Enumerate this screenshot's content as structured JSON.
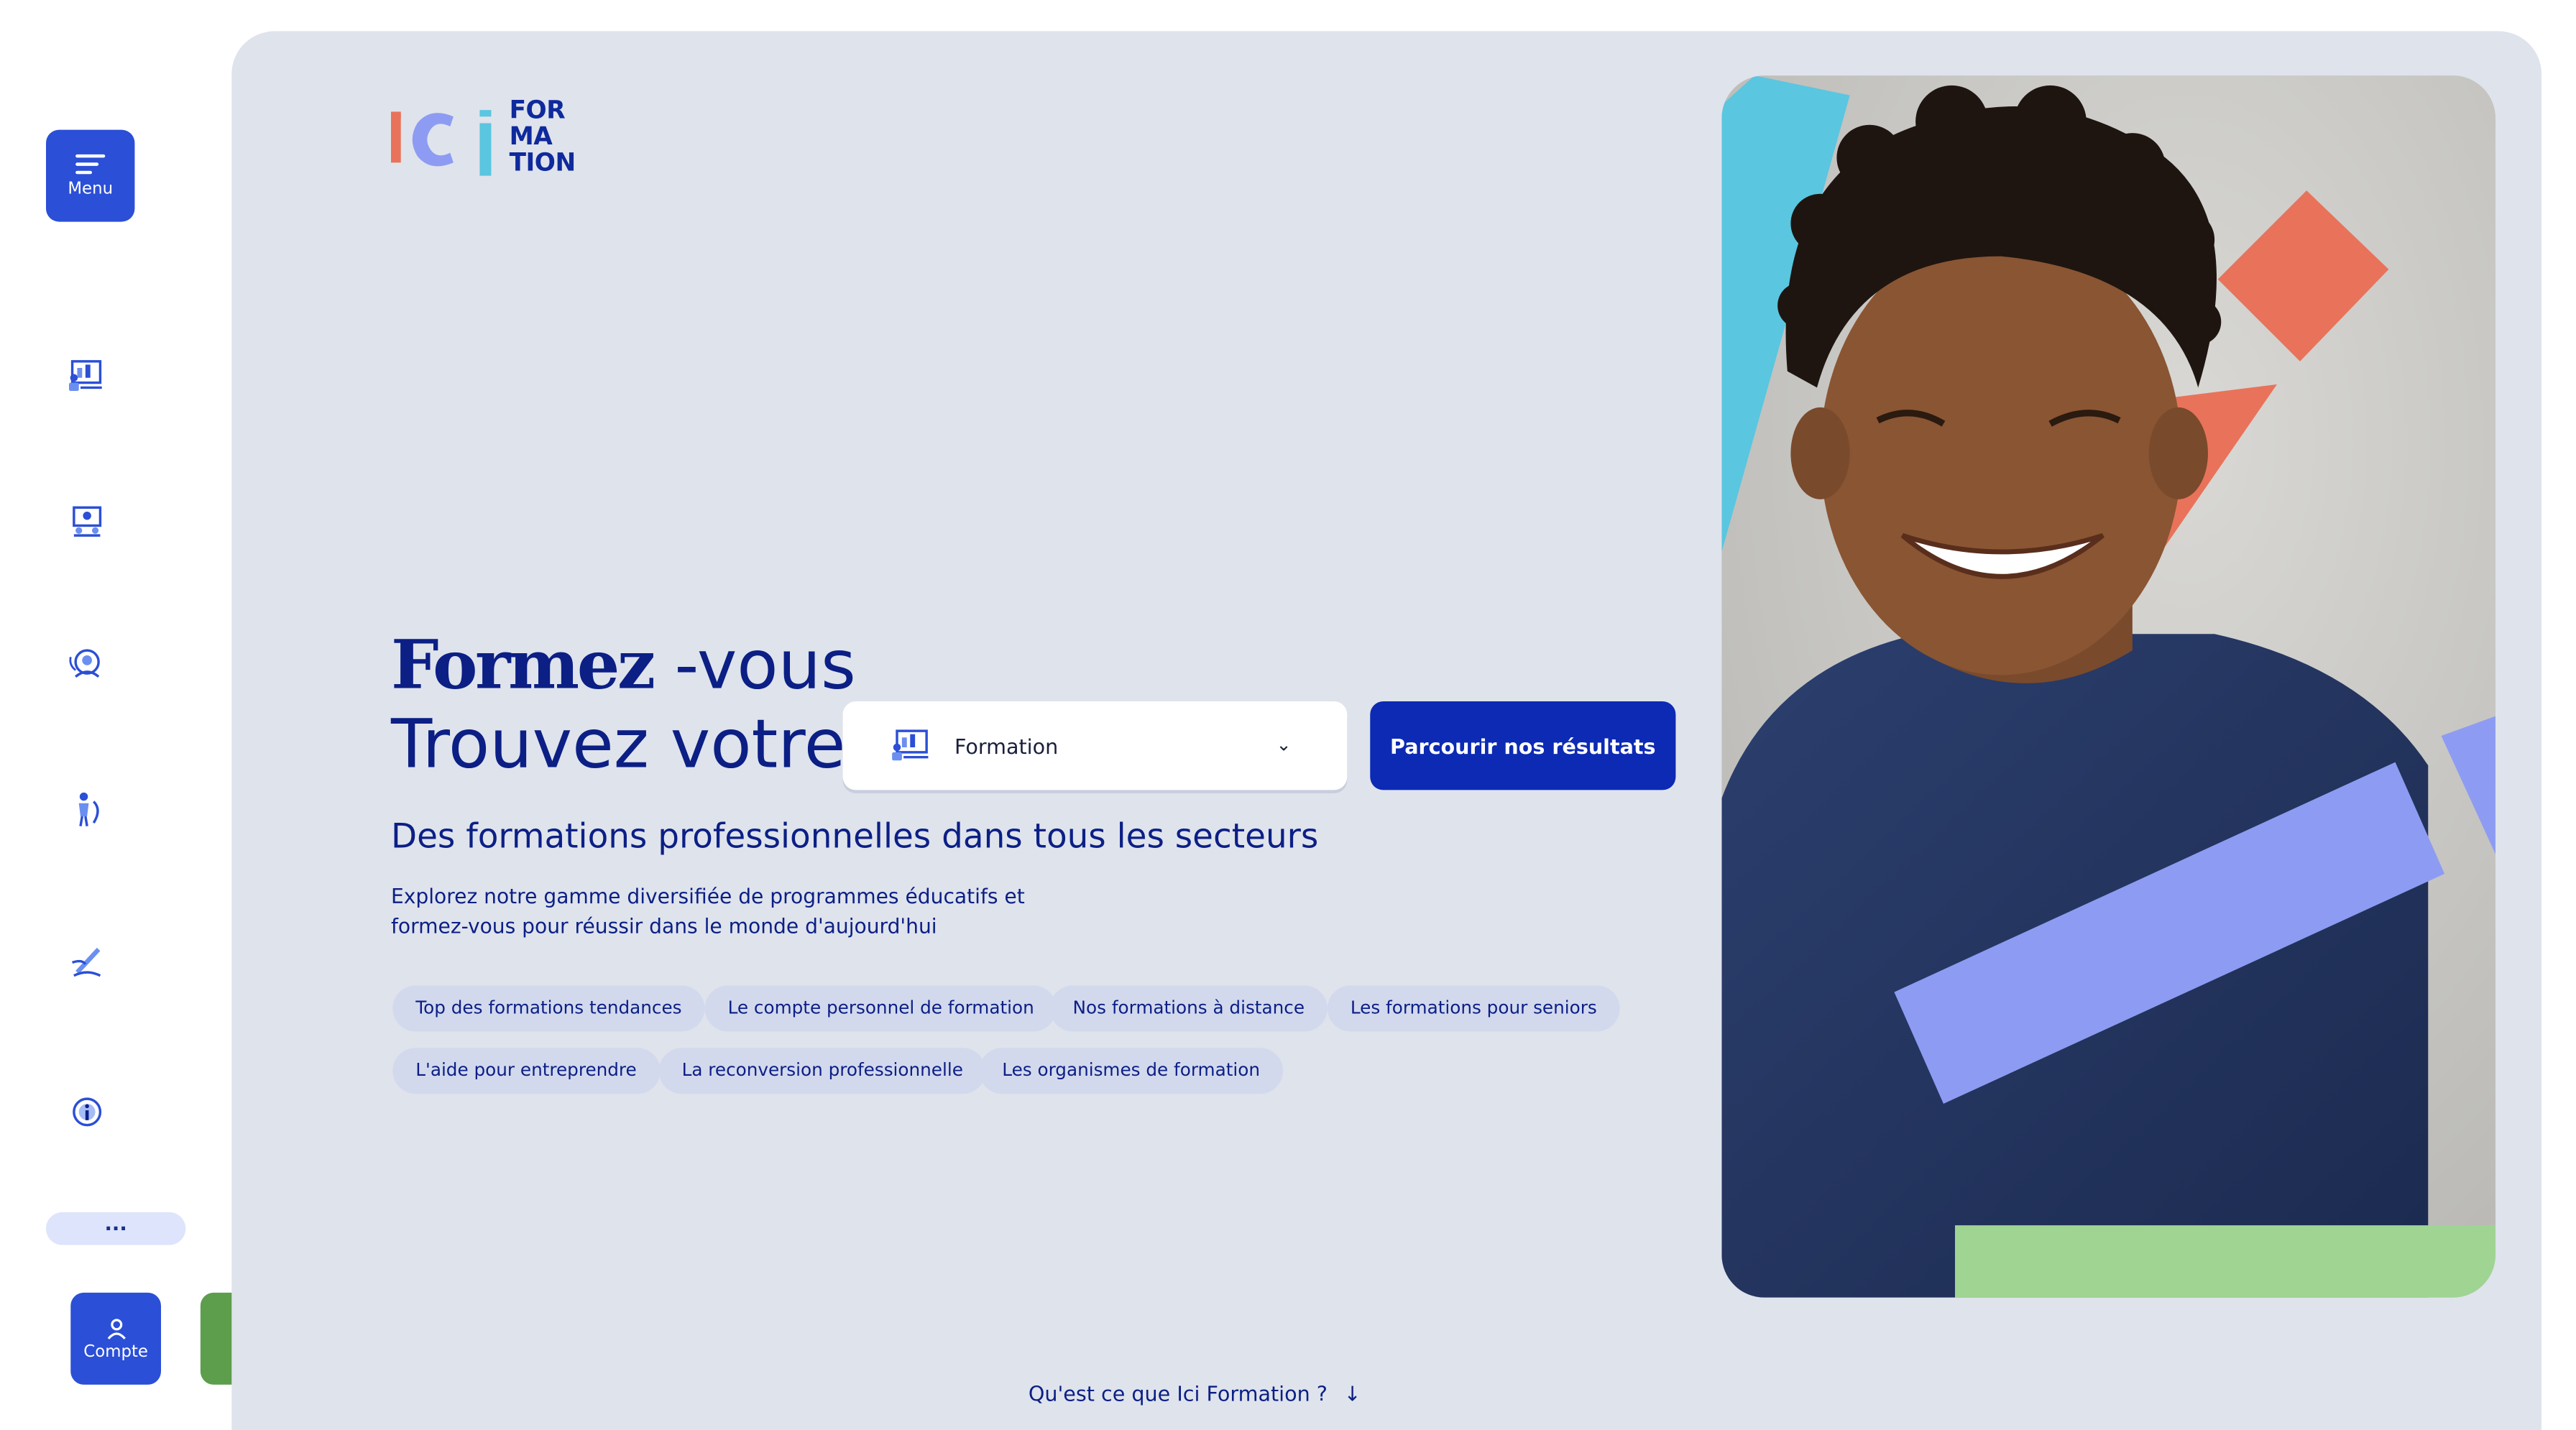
{
  "sidebar": {
    "menu_label": "Menu",
    "nav_icons": [
      "formation-icon",
      "classroom-icon",
      "distance-learning-icon",
      "senior-icon",
      "entrepreneur-icon",
      "info-icon"
    ],
    "more_label": "...",
    "account_label": "Compte"
  },
  "logo": {
    "mark": "iCi",
    "line1": "FOR",
    "line2": "MA",
    "line3": "TION"
  },
  "hero": {
    "title_bold": "Formez",
    "title_rest": " -vous",
    "title_line2": "Trouvez votre",
    "search_select_value": "Formation",
    "cta_label": "Parcourir nos résultats",
    "subtitle": "Des formations professionnelles dans tous les secteurs",
    "description_line1": "Explorez notre gamme diversifiée de programmes éducatifs et",
    "description_line2": "formez-vous pour réussir dans le monde d'aujourd'hui"
  },
  "chips": [
    "Top des formations tendances",
    "Le compte personnel de formation",
    "Nos formations à distance",
    "Les formations pour seniors",
    "L'aide pour entreprendre",
    "La reconversion professionnelle",
    "Les organismes de formation"
  ],
  "footer_link": "Qu'est ce que Ici Formation ?",
  "colors": {
    "primary": "#2b4fd6",
    "navy": "#0b1f85",
    "cta": "#0c2ab3",
    "panel": "#dfe3ec",
    "green": "#5d9e4d",
    "coral": "#e8735a",
    "cyan": "#5ac6e0",
    "periwinkle": "#8d9cf2",
    "mint": "#9fd493"
  }
}
